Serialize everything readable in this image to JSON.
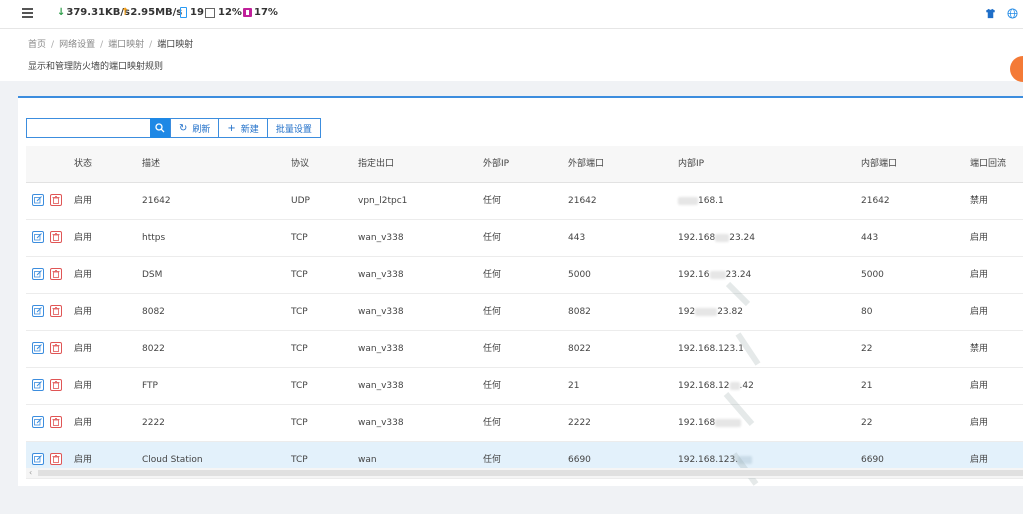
{
  "topbar": {
    "download_speed": "379.31KB/s",
    "upload_speed": "2.95MB/s",
    "devices": "19",
    "cpu": "12%",
    "memory": "17%",
    "colors": {
      "down_arrow": "#2e9e4a",
      "up_arrow": "#f39c12",
      "accent": "#1e88e5"
    }
  },
  "breadcrumb": [
    "首页",
    "网络设置",
    "端口映射",
    "端口映射"
  ],
  "page_description": "显示和管理防火墙的端口映射规则",
  "toolbar": {
    "search_placeholder": "",
    "refresh_label": "刷新",
    "new_label": "新建",
    "batch_label": "批量设置"
  },
  "table": {
    "columns": {
      "status": "状态",
      "description": "描述",
      "protocol": "协议",
      "interface": "指定出口",
      "external_ip": "外部IP",
      "external_port": "外部端口",
      "internal_ip": "内部IP",
      "internal_port": "内部端口",
      "loopback": "端口回流"
    },
    "rows": [
      {
        "status": "启用",
        "description": "21642",
        "protocol": "UDP",
        "interface": "vpn_l2tpc1",
        "external_ip": "任何",
        "external_port": "21642",
        "internal_ip_a": "",
        "internal_ip_b": "168.1",
        "internal_port": "21642",
        "loopback": "禁用"
      },
      {
        "status": "启用",
        "description": "https",
        "protocol": "TCP",
        "interface": "wan_v338",
        "external_ip": "任何",
        "external_port": "443",
        "internal_ip_a": "192.168",
        "internal_ip_b": "23.24",
        "internal_port": "443",
        "loopback": "启用"
      },
      {
        "status": "启用",
        "description": "DSM",
        "protocol": "TCP",
        "interface": "wan_v338",
        "external_ip": "任何",
        "external_port": "5000",
        "internal_ip_a": "192.16",
        "internal_ip_b": "23.24",
        "internal_port": "5000",
        "loopback": "启用"
      },
      {
        "status": "启用",
        "description": "8082",
        "protocol": "TCP",
        "interface": "wan_v338",
        "external_ip": "任何",
        "external_port": "8082",
        "internal_ip_a": "192",
        "internal_ip_b": "23.82",
        "internal_port": "80",
        "loopback": "启用"
      },
      {
        "status": "启用",
        "description": "8022",
        "protocol": "TCP",
        "interface": "wan_v338",
        "external_ip": "任何",
        "external_port": "8022",
        "internal_ip_a": "192.168.123.1",
        "internal_ip_b": "",
        "internal_port": "22",
        "loopback": "禁用"
      },
      {
        "status": "启用",
        "description": "FTP",
        "protocol": "TCP",
        "interface": "wan_v338",
        "external_ip": "任何",
        "external_port": "21",
        "internal_ip_a": "192.168.12",
        "internal_ip_b": ".42",
        "internal_port": "21",
        "loopback": "启用"
      },
      {
        "status": "启用",
        "description": "2222",
        "protocol": "TCP",
        "interface": "wan_v338",
        "external_ip": "任何",
        "external_port": "2222",
        "internal_ip_a": "192.168",
        "internal_ip_b": "",
        "internal_port": "22",
        "loopback": "启用"
      },
      {
        "status": "启用",
        "description": "Cloud Station",
        "protocol": "TCP",
        "interface": "wan",
        "external_ip": "任何",
        "external_port": "6690",
        "internal_ip_a": "192.168.123.",
        "internal_ip_b": "",
        "internal_port": "6690",
        "loopback": "启用"
      }
    ]
  }
}
